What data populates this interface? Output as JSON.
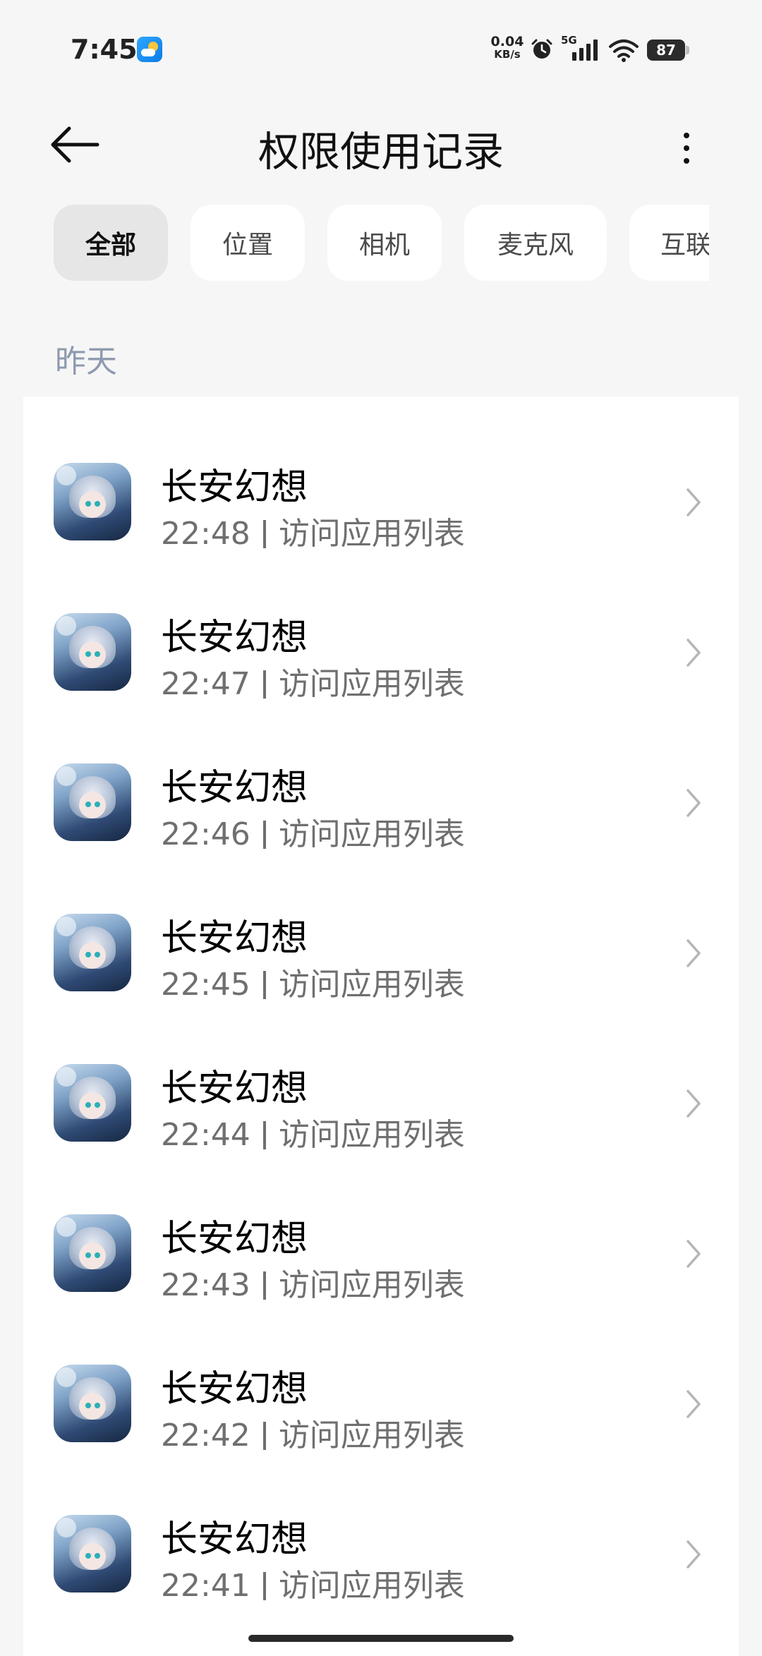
{
  "status_bar": {
    "time": "7:45",
    "net_speed_value": "0.04",
    "net_speed_unit": "KB/s",
    "network_type": "5G",
    "battery": "87"
  },
  "header": {
    "title": "权限使用记录"
  },
  "filters": [
    {
      "label": "全部",
      "active": true
    },
    {
      "label": "位置",
      "active": false
    },
    {
      "label": "相机",
      "active": false
    },
    {
      "label": "麦克风",
      "active": false
    },
    {
      "label": "互联",
      "active": false
    }
  ],
  "section": {
    "title": "昨天"
  },
  "records": [
    {
      "app": "长安幻想",
      "time": "22:48",
      "action": "访问应用列表"
    },
    {
      "app": "长安幻想",
      "time": "22:47",
      "action": "访问应用列表"
    },
    {
      "app": "长安幻想",
      "time": "22:46",
      "action": "访问应用列表"
    },
    {
      "app": "长安幻想",
      "time": "22:45",
      "action": "访问应用列表"
    },
    {
      "app": "长安幻想",
      "time": "22:44",
      "action": "访问应用列表"
    },
    {
      "app": "长安幻想",
      "time": "22:43",
      "action": "访问应用列表"
    },
    {
      "app": "长安幻想",
      "time": "22:42",
      "action": "访问应用列表"
    },
    {
      "app": "长安幻想",
      "time": "22:41",
      "action": "访问应用列表"
    }
  ],
  "icons": {
    "back": "arrow-left-icon",
    "more": "more-vertical-icon",
    "chevron": "chevron-right-icon",
    "alarm": "alarm-icon",
    "wifi": "wifi-icon",
    "weather": "weather-icon"
  }
}
